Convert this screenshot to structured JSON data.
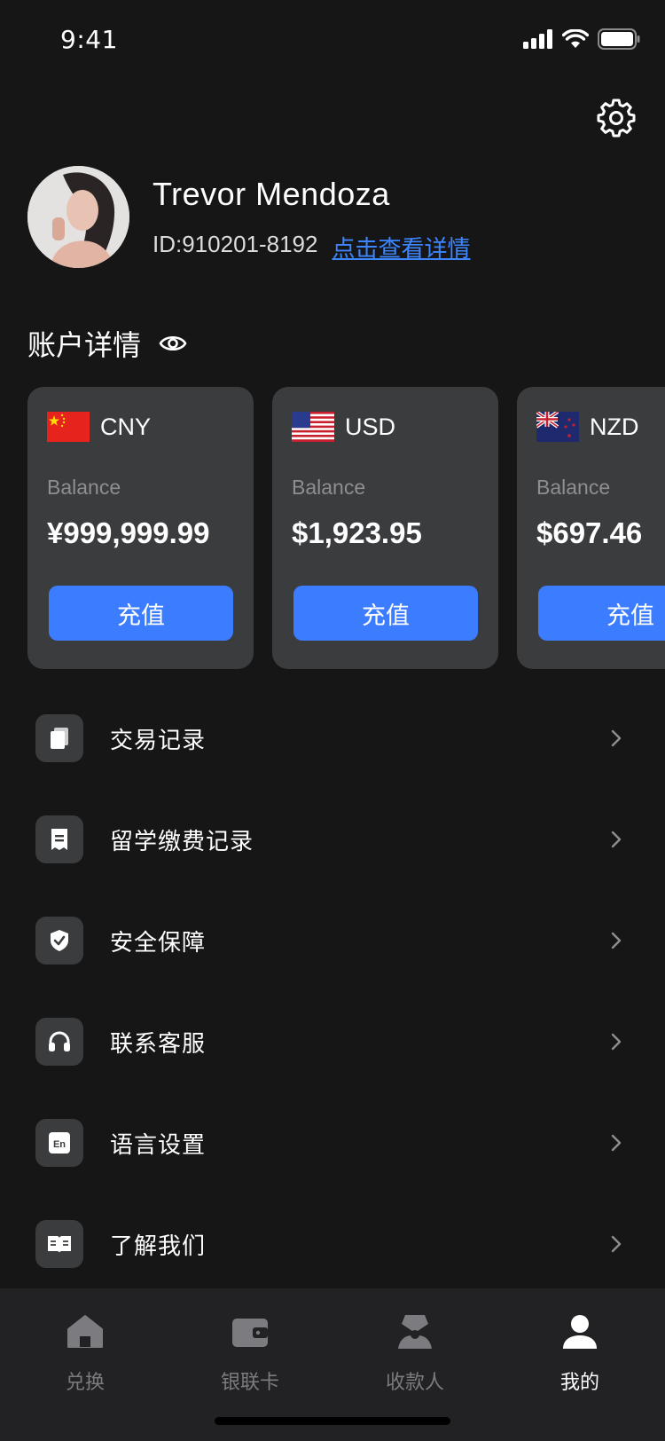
{
  "status_bar": {
    "time": "9:41"
  },
  "profile": {
    "name": "Trevor Mendoza",
    "id": "ID:910201-8192",
    "details_link": "点击查看详情"
  },
  "account": {
    "title": "账户详情",
    "cards": [
      {
        "currency": "CNY",
        "flag": "cn-flag",
        "balance_label": "Balance",
        "balance": "¥999,999.99",
        "button": "充值"
      },
      {
        "currency": "USD",
        "flag": "us-flag",
        "balance_label": "Balance",
        "balance": "$1,923.95",
        "button": "充值"
      },
      {
        "currency": "NZD",
        "flag": "nz-flag",
        "balance_label": "Balance",
        "balance": "$697.46",
        "button": "充值"
      }
    ]
  },
  "menu": [
    {
      "label": "交易记录",
      "icon": "transactions-icon"
    },
    {
      "label": "留学缴费记录",
      "icon": "tuition-icon"
    },
    {
      "label": "安全保障",
      "icon": "shield-icon"
    },
    {
      "label": "联系客服",
      "icon": "headphones-icon"
    },
    {
      "label": "语言设置",
      "icon": "language-icon",
      "icon_text": "En"
    },
    {
      "label": "了解我们",
      "icon": "book-icon"
    }
  ],
  "tabbar": [
    {
      "label": "兑换",
      "icon": "home-icon",
      "active": false
    },
    {
      "label": "银联卡",
      "icon": "wallet-icon",
      "active": false
    },
    {
      "label": "收款人",
      "icon": "payee-icon",
      "active": false
    },
    {
      "label": "我的",
      "icon": "user-icon",
      "active": true
    }
  ],
  "colors": {
    "accent": "#3c7cff",
    "link": "#3d86ff",
    "card": "#3b3c3e",
    "background": "#161616"
  }
}
